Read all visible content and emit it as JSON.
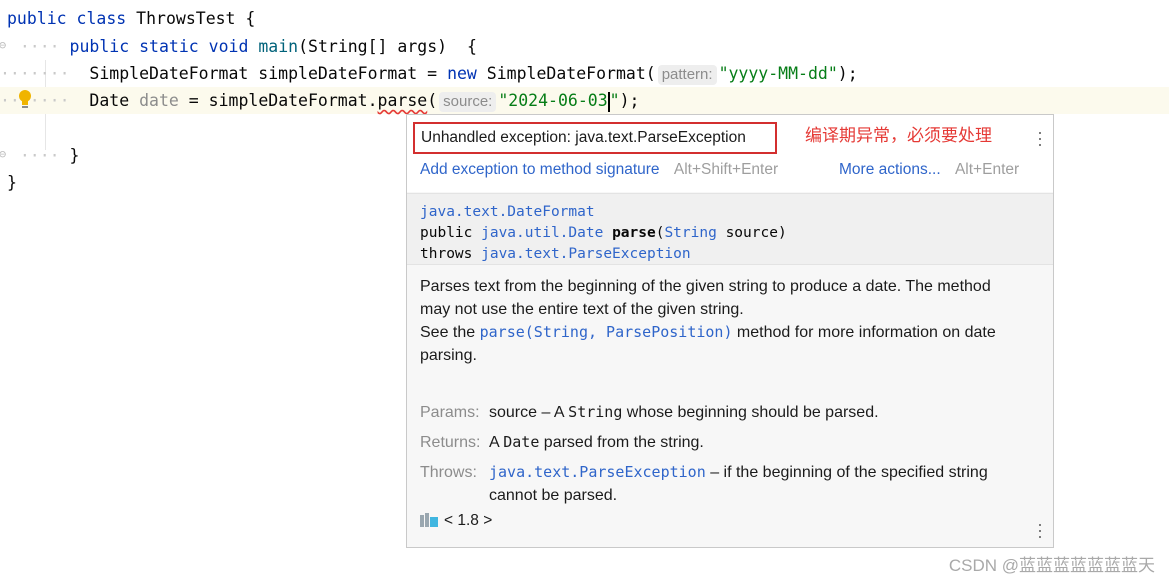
{
  "code": {
    "line1": {
      "kw1": "public",
      "kw2": "class",
      "name": "ThrowsTest",
      "brace": " {"
    },
    "line2": {
      "kw1": "public",
      "kw2": "static",
      "kw3": "void",
      "method": "main",
      "params": "(String[] args)",
      "brace": "  {"
    },
    "line3": {
      "type": "SimpleDateFormat",
      "var": "simpleDateFormat",
      "eq": " = ",
      "kw": "new",
      "ctor": " SimpleDateFormat(",
      "hint": "pattern:",
      "str": "\"yyyy-MM-dd\"",
      "end": ");"
    },
    "line4": {
      "type": "Date",
      "var": "date",
      "eq": " = ",
      "recv": "simpleDateFormat.",
      "call": "parse",
      "open": "(",
      "hint": "source:",
      "str_a": "\"2024-06-03",
      "str_b": "\"",
      "end": ");"
    },
    "line6": {
      "brace": "}"
    },
    "line7": {
      "brace": "}"
    }
  },
  "popup": {
    "error": "Unhandled exception: java.text.ParseException",
    "annotation": "编译期异常，必须要处理",
    "action_add": "Add exception to method signature",
    "action_add_shortcut": "Alt+Shift+Enter",
    "action_more": "More actions...",
    "action_more_shortcut": "Alt+Enter",
    "sig_class": "java.text.DateFormat",
    "sig_public": "public ",
    "sig_return": "java.util.Date",
    "sig_name": "parse",
    "sig_open": "(",
    "sig_param_type": "String",
    "sig_param": " source)",
    "sig_throws": "throws ",
    "sig_exception": "java.text.ParseException",
    "doc_p1": "Parses text from the beginning of the given string to produce a date. The method may not use the entire text of the given string.",
    "doc_p2_a": "See the ",
    "doc_p2_link": "parse(String, ParsePosition)",
    "doc_p2_b": " method for more information on date parsing.",
    "params_label": "Params:",
    "params_a": "source – A ",
    "params_code": "String",
    "params_b": " whose beginning should be parsed.",
    "returns_label": "Returns:",
    "returns_a": "A ",
    "returns_code": "Date",
    "returns_b": " parsed from the string.",
    "throws_label": "Throws:",
    "throws_link": "java.text.ParseException",
    "throws_b": " – if the beginning of the specified string cannot be parsed.",
    "since": "< 1.8 >"
  },
  "watermark": "CSDN @蓝蓝蓝蓝蓝蓝蓝天",
  "colors": {
    "keyword": "#0033b3",
    "string": "#067d17",
    "link": "#2f65ca",
    "error_border": "#d32f2f",
    "annotation": "#e53935"
  }
}
